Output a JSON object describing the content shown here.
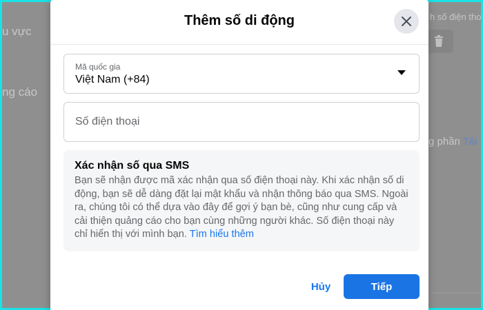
{
  "background": {
    "left_texts": [
      "u vực",
      "ng cáo"
    ],
    "right_top_text": "h số điện thoại",
    "right_mid_text": "g phần",
    "right_mid_link": "Tải"
  },
  "modal": {
    "title": "Thêm số di động",
    "country_field": {
      "label": "Mã quốc gia",
      "value": "Việt Nam (+84)"
    },
    "phone_field": {
      "placeholder": "Số điện thoại",
      "value": ""
    },
    "info": {
      "title": "Xác nhận số qua SMS",
      "body": "Bạn sẽ nhận được mã xác nhận qua số điện thoại này. Khi xác nhận số di động, bạn sẽ dễ dàng đặt lại mật khẩu và nhận thông báo qua SMS. Ngoài ra, chúng tôi có thể dựa vào đây để gợi ý bạn bè, cũng như cung cấp và cải thiện quảng cáo cho bạn cùng những người khác. Số điện thoại này chỉ hiển thị với mình bạn.",
      "link": "Tìm hiểu thêm"
    },
    "cancel_label": "Hủy",
    "next_label": "Tiếp"
  },
  "colors": {
    "accent": "#1877f2",
    "overlay": "#8f8f8f",
    "frame_border": "#19e3e6"
  },
  "icons": {
    "close": "close-icon",
    "dropdown": "caret-down-icon",
    "trash": "trash-icon"
  }
}
